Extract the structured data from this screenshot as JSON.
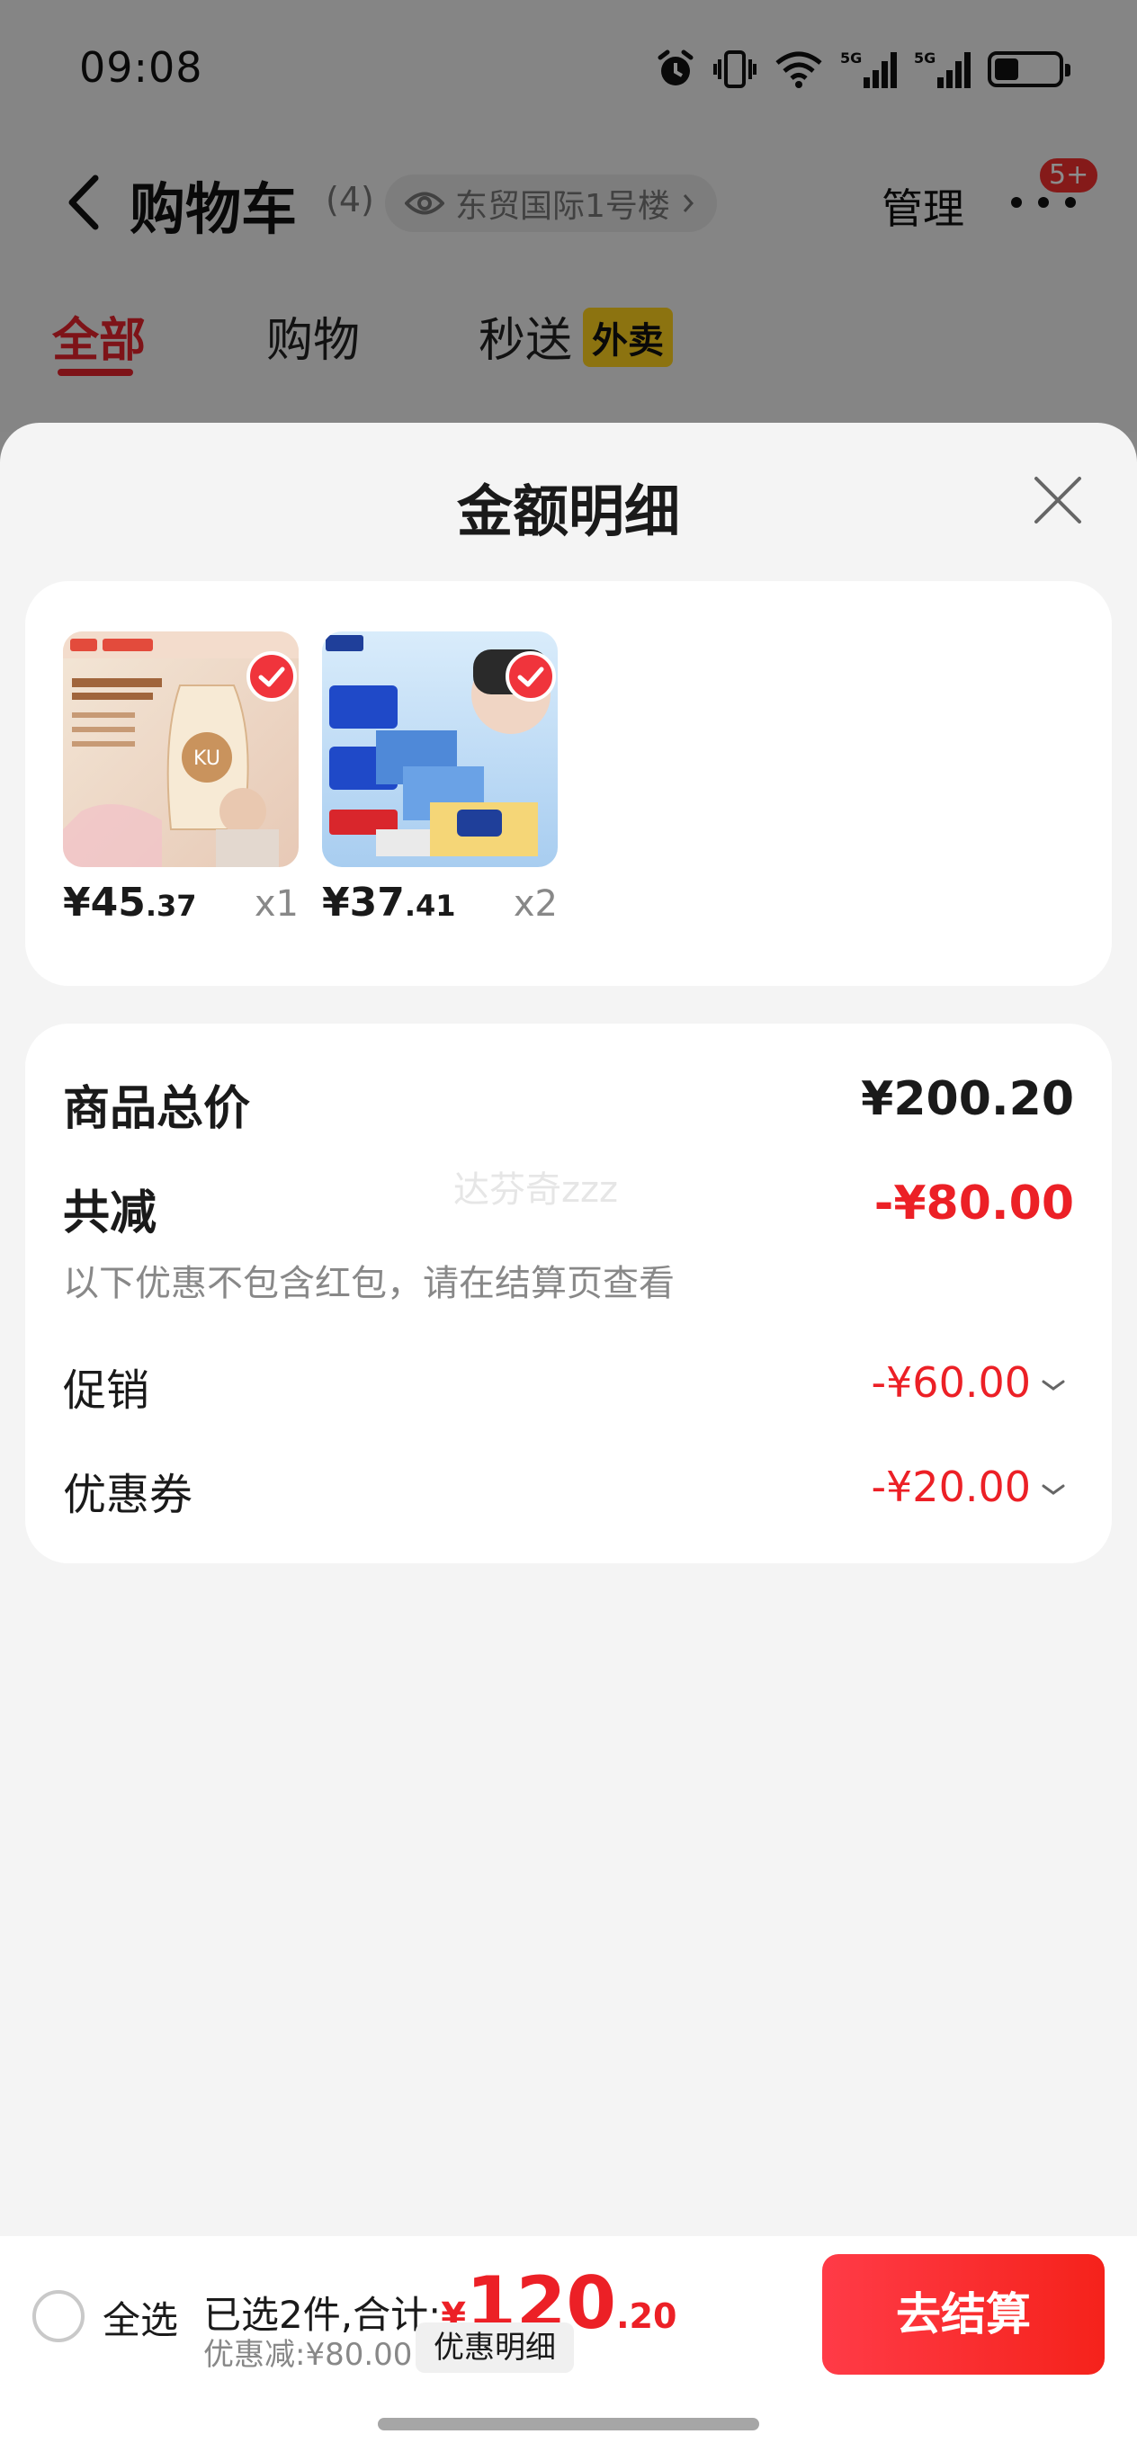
{
  "status": {
    "time": "09:08",
    "icons": [
      "alarm-icon",
      "vibrate-icon",
      "wifi-icon",
      "signal-5g-icon",
      "signal-5g-icon",
      "battery-icon"
    ]
  },
  "nav": {
    "title": "购物车",
    "count": "(4)",
    "address": "东贸国际1号楼",
    "manage": "管理",
    "badge": "5+"
  },
  "tabs": [
    {
      "label": "全部",
      "active": true
    },
    {
      "label": "购物",
      "active": false
    },
    {
      "label": "秒送",
      "active": false,
      "tag": "外卖"
    }
  ],
  "sheet": {
    "title": "金额明细",
    "products": [
      {
        "price_int": "¥45",
        "price_dec": ".37",
        "qty": "x1",
        "checked": true
      },
      {
        "price_int": "¥37",
        "price_dec": ".41",
        "qty": "x2",
        "checked": true
      }
    ],
    "detail": {
      "total_label": "商品总价",
      "total_value": "¥200.20",
      "reduce_label": "共减",
      "reduce_value": "-¥80.00",
      "note": "以下优惠不包含红包，请在结算页查看",
      "promo_label": "促销",
      "promo_value": "-¥60.00",
      "coupon_label": "优惠券",
      "coupon_value": "-¥20.00",
      "watermark": "达芬奇zzz"
    }
  },
  "bottom": {
    "select_all": "全选",
    "summary_prefix": "已选2件,合计:",
    "currency": "¥",
    "amount_int": "120",
    "amount_dec": ".20",
    "discount_text": "优惠减:¥80.00",
    "discount_detail_btn": "优惠明细",
    "checkout": "去结算"
  },
  "colors": {
    "accent_red": "#ec2026",
    "tag_yellow": "#ffd21e"
  }
}
